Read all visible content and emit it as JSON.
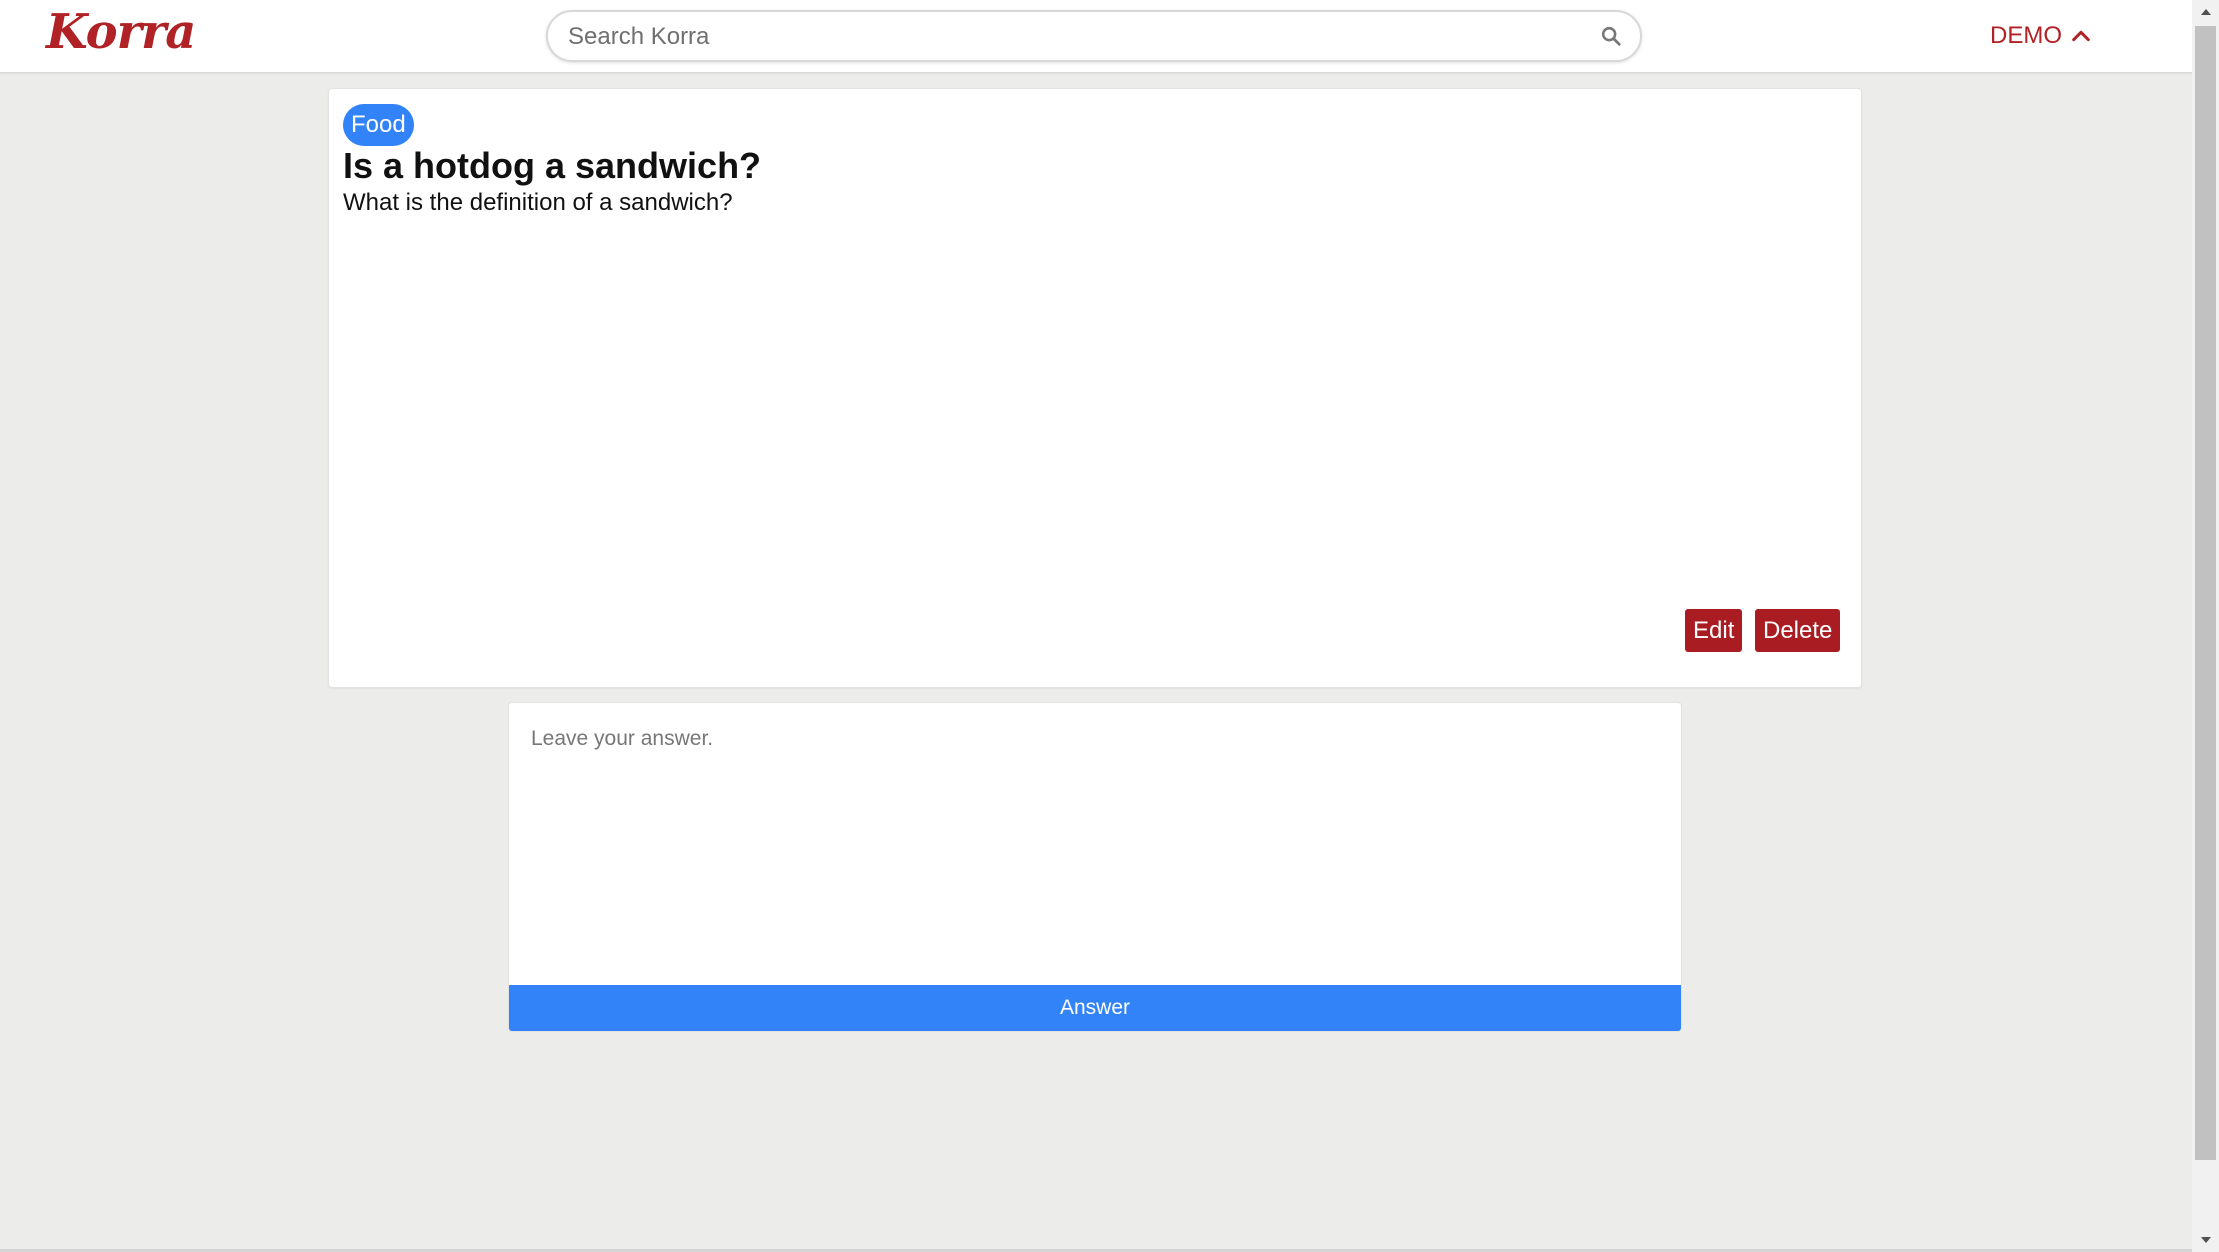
{
  "header": {
    "logo": "Korra",
    "search": {
      "placeholder": "Search Korra",
      "value": ""
    },
    "user_menu_label": "DEMO"
  },
  "question": {
    "topic": "Food",
    "title": "Is a hotdog a sandwich?",
    "body": "What is the definition of a sandwich?",
    "edit_label": "Edit",
    "delete_label": "Delete"
  },
  "answer_form": {
    "placeholder": "Leave your answer.",
    "submit_label": "Answer"
  },
  "icons": {
    "search": "search-icon",
    "user_menu": "chevron-up-icon",
    "scroll_up": "arrow-up-icon",
    "scroll_down": "arrow-down-icon"
  },
  "colors": {
    "brand_red": "#b02225",
    "button_red": "#a91c21",
    "accent_blue": "#3183f7",
    "page_background": "#ececeb"
  }
}
